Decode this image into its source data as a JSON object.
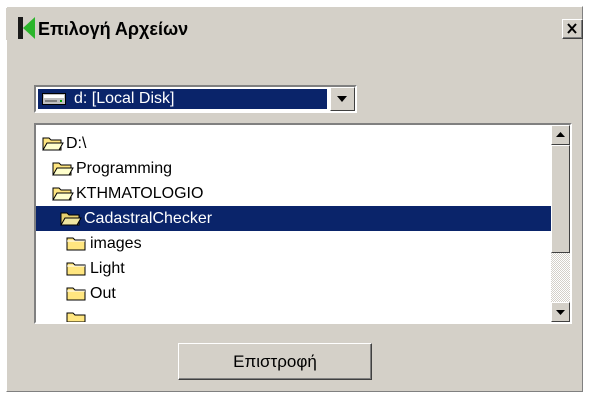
{
  "dialog": {
    "title": "Επιλογή Αρχείων",
    "close_icon": "close-icon",
    "logo_icon": "app-logo-icon"
  },
  "drive_select": {
    "value": "d: [Local Disk]",
    "icon": "hard-drive-icon",
    "dropdown_icon": "chevron-down-icon"
  },
  "folder_tree": {
    "items": [
      {
        "label": "D:\\",
        "icon": "folder-open-icon",
        "depth": 0,
        "selected": false
      },
      {
        "label": "Programming",
        "icon": "folder-open-icon",
        "depth": 1,
        "selected": false
      },
      {
        "label": "KTHMATOLOGIO",
        "icon": "folder-open-icon",
        "depth": 2,
        "selected": false
      },
      {
        "label": "CadastralChecker",
        "icon": "folder-open-icon",
        "depth": 3,
        "selected": true
      },
      {
        "label": "images",
        "icon": "folder-closed-icon",
        "depth": 4,
        "selected": false
      },
      {
        "label": "Light",
        "icon": "folder-closed-icon",
        "depth": 4,
        "selected": false
      },
      {
        "label": "Out",
        "icon": "folder-closed-icon",
        "depth": 4,
        "selected": false
      }
    ]
  },
  "footer": {
    "return_label": "Επιστροφή"
  },
  "colors": {
    "face": "#d4d0c8",
    "selection": "#0a246a",
    "folder": "#ffe680"
  }
}
